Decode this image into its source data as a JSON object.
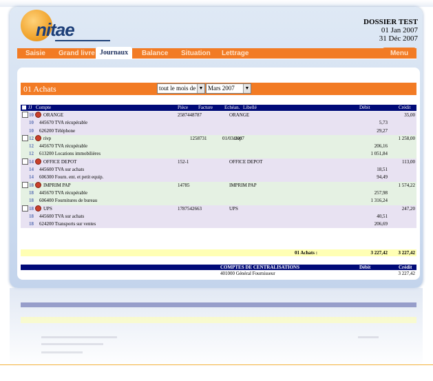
{
  "app": {
    "logo_text": "nitae"
  },
  "dossier": {
    "title": "DOSSIER TEST",
    "date_start": "01 Jan 2007",
    "date_end": "31 Déc 2007"
  },
  "nav": {
    "tabs": [
      "Saisie",
      "Grand livre",
      "Journaux",
      "Balance",
      "Situation",
      "Lettrage"
    ],
    "active": "Journaux",
    "menu": "Menu"
  },
  "journal": {
    "title": "01 Achats",
    "period_select": "tout le mois de",
    "month_select": "Mars 2007"
  },
  "table": {
    "headers": {
      "jj": "JJ",
      "compte": "Compte",
      "piece": "Pièce",
      "facture": "Facture",
      "echeance": "Echéan.",
      "libelle": "Libellé",
      "debit": "Débit",
      "credit": "Crédit"
    },
    "rows": [
      {
        "jj": "10",
        "compte": "ORANGE",
        "piece": "",
        "facture": "2587448787",
        "echeance": "",
        "libelle": "ORANGE",
        "debit": "",
        "credit": "35,00",
        "head": true,
        "group": 1
      },
      {
        "jj": "10",
        "compte": "445670 TVA récupérable",
        "piece": "",
        "facture": "",
        "echeance": "",
        "libelle": "",
        "debit": "5,73",
        "credit": "",
        "head": false,
        "group": 1
      },
      {
        "jj": "10",
        "compte": "626200 Téléphone",
        "piece": "",
        "facture": "",
        "echeance": "",
        "libelle": "",
        "debit": "29,27",
        "credit": "",
        "head": false,
        "group": 1
      },
      {
        "jj": "12",
        "compte": "rivp",
        "piece": "",
        "facture": "1258731",
        "echeance": "01/03/2007",
        "libelle": "rivp",
        "debit": "",
        "credit": "1 258,00",
        "head": true,
        "group": 2
      },
      {
        "jj": "12",
        "compte": "445670 TVA récupérable",
        "piece": "",
        "facture": "",
        "echeance": "",
        "libelle": "",
        "debit": "206,16",
        "credit": "",
        "head": false,
        "group": 2
      },
      {
        "jj": "12",
        "compte": "613200 Locations immobilières",
        "piece": "",
        "facture": "",
        "echeance": "",
        "libelle": "",
        "debit": "1 051,84",
        "credit": "",
        "head": false,
        "group": 2
      },
      {
        "jj": "14",
        "compte": "OFFICE DEPOT",
        "piece": "",
        "facture": "152-1",
        "echeance": "",
        "libelle": "OFFICE DEPOT",
        "debit": "",
        "credit": "113,00",
        "head": true,
        "group": 1
      },
      {
        "jj": "14",
        "compte": "445600 TVA sur achats",
        "piece": "",
        "facture": "",
        "echeance": "",
        "libelle": "",
        "debit": "18,51",
        "credit": "",
        "head": false,
        "group": 1
      },
      {
        "jj": "14",
        "compte": "606300 Fourn. ent. et petit equip.",
        "piece": "",
        "facture": "",
        "echeance": "",
        "libelle": "",
        "debit": "94,49",
        "credit": "",
        "head": false,
        "group": 1
      },
      {
        "jj": "18",
        "compte": "IMPRIM PAP",
        "piece": "",
        "facture": "14785",
        "echeance": "",
        "libelle": "IMPRIM PAP",
        "debit": "",
        "credit": "1 574,22",
        "head": true,
        "group": 2
      },
      {
        "jj": "18",
        "compte": "445670 TVA récupérable",
        "piece": "",
        "facture": "",
        "echeance": "",
        "libelle": "",
        "debit": "257,98",
        "credit": "",
        "head": false,
        "group": 2
      },
      {
        "jj": "18",
        "compte": "606400 Fournitures de bureau",
        "piece": "",
        "facture": "",
        "echeance": "",
        "libelle": "",
        "debit": "1 316,24",
        "credit": "",
        "head": false,
        "group": 2
      },
      {
        "jj": "18",
        "compte": "UPS",
        "piece": "",
        "facture": "1787542663",
        "echeance": "",
        "libelle": "UPS",
        "debit": "",
        "credit": "247,20",
        "head": true,
        "group": 1
      },
      {
        "jj": "18",
        "compte": "445600 TVA sur achats",
        "piece": "",
        "facture": "",
        "echeance": "",
        "libelle": "",
        "debit": "40,51",
        "credit": "",
        "head": false,
        "group": 1
      },
      {
        "jj": "18",
        "compte": "624200 Transports sur ventes",
        "piece": "",
        "facture": "",
        "echeance": "",
        "libelle": "",
        "debit": "206,69",
        "credit": "",
        "head": false,
        "group": 1
      }
    ],
    "total": {
      "label": "01 Achats :",
      "debit": "3 227,42",
      "credit": "3 227,42"
    }
  },
  "centralisation": {
    "header": "COMPTES DE CENTRALISATIONS",
    "debit_label": "Débit",
    "credit_label": "Crédit",
    "line": {
      "compte": "401000 Général Fournisseur",
      "debit": "",
      "credit": "3 227,42"
    }
  }
}
